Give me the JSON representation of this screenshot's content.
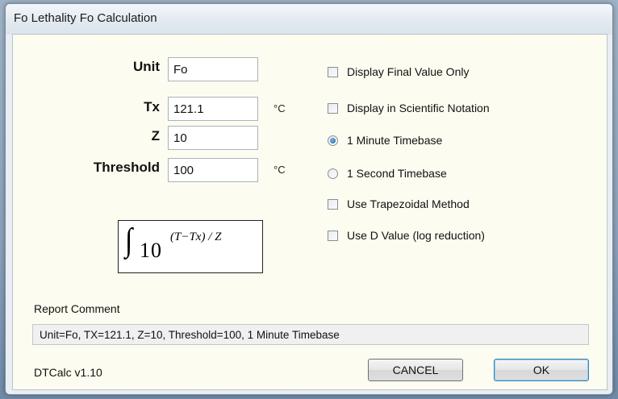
{
  "window": {
    "title": "Fo Lethality Fo Calculation"
  },
  "fields": {
    "unit": {
      "label": "Unit",
      "value": "Fo"
    },
    "tx": {
      "label": "Tx",
      "value": "121.1",
      "unit": "°C"
    },
    "z": {
      "label": "Z",
      "value": "10"
    },
    "threshold": {
      "label": "Threshold",
      "value": "100",
      "unit": "°C"
    }
  },
  "formula": {
    "integral": "∫",
    "base": "10",
    "exponent": "(T−Tx) / Z"
  },
  "options": [
    {
      "type": "checkbox",
      "label": "Display Final Value Only",
      "checked": false
    },
    {
      "type": "checkbox",
      "label": "Display in Scientific Notation",
      "checked": false
    },
    {
      "type": "radio",
      "label": "1 Minute Timebase",
      "checked": true
    },
    {
      "type": "radio",
      "label": "1 Second Timebase",
      "checked": false
    },
    {
      "type": "checkbox",
      "label": "Use Trapezoidal Method",
      "checked": false
    },
    {
      "type": "checkbox",
      "label": "Use D Value (log reduction)",
      "checked": false
    }
  ],
  "report": {
    "label": "Report Comment",
    "value": "Unit=Fo,  TX=121.1,  Z=10,  Threshold=100,  1 Minute Timebase"
  },
  "footer": {
    "version": "DTCalc v1.10"
  },
  "buttons": {
    "cancel": "CANCEL",
    "ok": "OK"
  },
  "colors": {
    "client_bg": "#fcfcf0",
    "ok_border": "#3c7fb1"
  }
}
